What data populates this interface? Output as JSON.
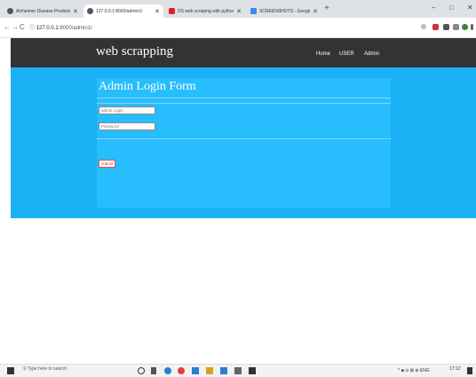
{
  "browser": {
    "tabs": [
      {
        "title": "Alzheimer Disease Prediction usi",
        "active": false,
        "favicon_color": "#555555"
      },
      {
        "title": "127.0.0.1:8000/admin1/",
        "active": true,
        "favicon_color": "#555555"
      },
      {
        "title": "DS web scraping with python p",
        "active": false,
        "favicon_color": "#e02020"
      },
      {
        "title": "SCREENSHOTS - Google Docs",
        "active": false,
        "favicon_color": "#4285f4"
      }
    ],
    "new_tab": "+",
    "window_controls": {
      "minimize": "–",
      "maximize": "□",
      "close": "✕"
    },
    "nav": {
      "back": "←",
      "forward": "→",
      "reload": "C"
    },
    "url_prefix": "127.0.0.1",
    "url_rest": ":8000/admin1/",
    "toolbar_icon_colors": [
      "#777777",
      "#cc3333",
      "#555555",
      "#777777",
      "#3b7f3b",
      "#555555"
    ]
  },
  "site": {
    "brand": "web scrapping",
    "nav": [
      "Home",
      "USER",
      "Admin"
    ],
    "form": {
      "title": "Admin Login Form",
      "login_placeholder": "admin Login",
      "password_placeholder": "Password",
      "submit": "submit"
    },
    "colors": {
      "navbar": "#333333",
      "hero": "#1ab1f4",
      "panel": "#28bdfd"
    }
  },
  "taskbar": {
    "search_placeholder": "Type here to search",
    "icon_colors": [
      "#333333",
      "#555555",
      "#2a7fd4",
      "#e04040",
      "#2a7fd4",
      "#d8a020",
      "#2a7fd4",
      "#666666",
      "#333333"
    ],
    "tray_text": "^ ■ ⊙ ⊠ ⊕ ENG",
    "time": "17:12"
  }
}
